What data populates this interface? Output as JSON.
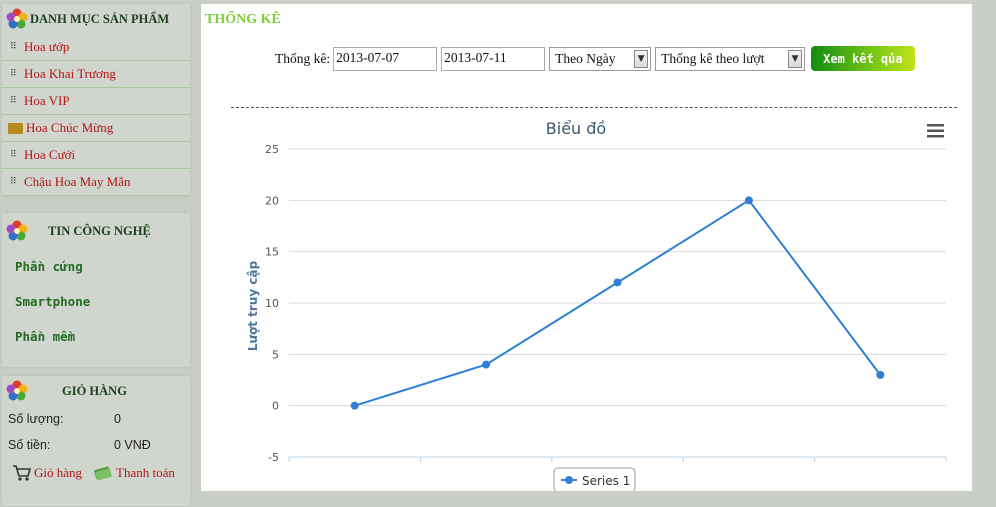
{
  "sidebar": {
    "categories": {
      "title": "DANH MỤC SẢN PHẨM",
      "items": [
        {
          "label": "Hoa ướp"
        },
        {
          "label": "Hoa Khai Trương"
        },
        {
          "label": "Hoa VIP"
        },
        {
          "label": "Hoa Chúc Mừng"
        },
        {
          "label": "Hoa Cưới"
        },
        {
          "label": "Chậu Hoa May Mắn"
        }
      ]
    },
    "tech": {
      "title": "TIN CÔNG NGHỆ",
      "items": [
        {
          "label": "Phần cứng"
        },
        {
          "label": "Smartphone"
        },
        {
          "label": "Phần mềm"
        }
      ]
    },
    "cart": {
      "title": "GIỎ HÀNG",
      "qty_label": "Số lượng:",
      "qty_value": "0",
      "amount_label": "Số tiền:",
      "amount_value": "0 VNĐ",
      "cart_link": "Giỏ hàng",
      "checkout_link": "Thanh toán"
    }
  },
  "main": {
    "title": "THỐNG KÊ",
    "filter": {
      "label": "Thống kê:",
      "date_from": "2013-07-07",
      "date_to": "2013-07-11",
      "period": "Theo Ngày",
      "metric": "Thống kê theo lượt",
      "submit": "Xem kết qủa"
    }
  },
  "colors": {
    "accent_green": "#7dcf3a",
    "link_red": "#b3141a",
    "series": "#2f7ed8"
  },
  "chart_data": {
    "type": "line",
    "title": "Biểu đồ",
    "ylabel": "Lượt truy cập",
    "xlabel": "",
    "categories": [
      "",
      "",
      "",
      "",
      ""
    ],
    "ylim": [
      -5,
      25
    ],
    "yticks": [
      -5,
      0,
      5,
      10,
      15,
      20,
      25
    ],
    "series": [
      {
        "name": "Series 1",
        "values": [
          0,
          4,
          12,
          20,
          3
        ]
      }
    ],
    "grid": true,
    "legend": "bottom-center"
  }
}
